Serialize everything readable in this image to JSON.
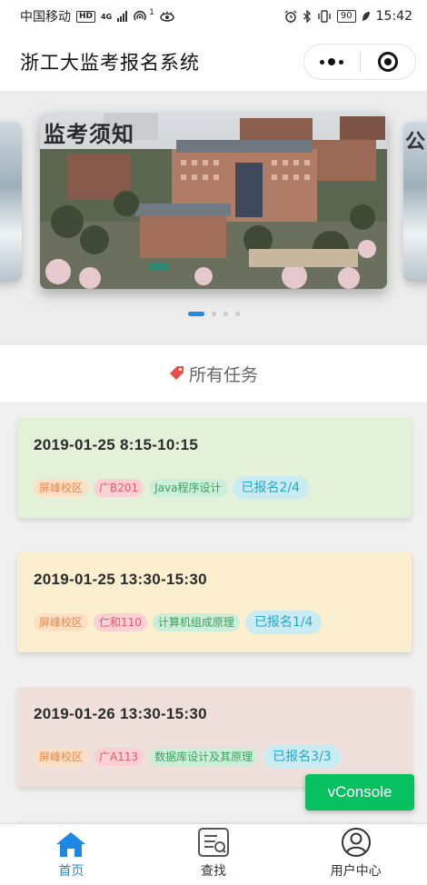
{
  "status_bar": {
    "carrier": "中国移动",
    "hd": "HD",
    "network": "4G",
    "notif_count": "1",
    "battery": "90",
    "time": "15:42"
  },
  "header": {
    "title": "浙工大监考报名系统"
  },
  "carousel": {
    "main_caption": "监考须知",
    "right_caption": "公",
    "slide_count": 4,
    "active_index": 0
  },
  "section": {
    "title": "所有任务",
    "icon": "tag-icon",
    "icon_color": "#e8504a"
  },
  "tasks": [
    {
      "time": "2019-01-25 8:15-10:15",
      "campus": "屏峰校区",
      "room": "广B201",
      "course": "Java程序设计",
      "signup": "已报名2/4",
      "bg": "#e3f1d8"
    },
    {
      "time": "2019-01-25 13:30-15:30",
      "campus": "屏峰校区",
      "room": "仁和110",
      "course": "计算机组成原理",
      "signup": "已报名1/4",
      "bg": "#fcefd0"
    },
    {
      "time": "2019-01-26 13:30-15:30",
      "campus": "屏峰校区",
      "room": "广A113",
      "course": "数据库设计及其原理",
      "signup": "已报名3/3",
      "bg": "#efe0db"
    }
  ],
  "vconsole": {
    "label": "vConsole"
  },
  "tabbar": {
    "items": [
      {
        "label": "首页",
        "icon": "home-icon",
        "active": true
      },
      {
        "label": "查找",
        "icon": "search-doc-icon",
        "active": false
      },
      {
        "label": "用户中心",
        "icon": "user-icon",
        "active": false
      }
    ],
    "active_color": "#1e88e5"
  }
}
